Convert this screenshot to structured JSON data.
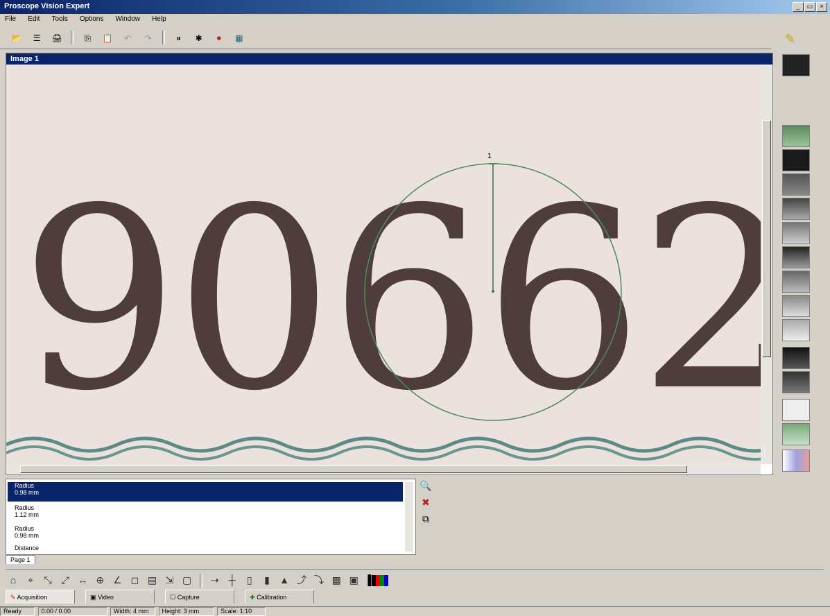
{
  "window": {
    "title": "Proscope Vision Expert",
    "controls": [
      "_",
      "▭",
      "×"
    ]
  },
  "menu": [
    "File",
    "Edit",
    "Tools",
    "Options",
    "Window",
    "Help"
  ],
  "toolbar": {
    "icons": [
      "open-icon",
      "save-icon",
      "print-icon",
      "copy-icon",
      "paste-icon",
      "undo-icon",
      "redo-icon",
      "pause-icon",
      "capture-icon",
      "record-icon",
      "settings-icon"
    ],
    "glyphs": [
      "📂",
      "☰",
      "🖨",
      "⎘",
      "📋",
      "↶",
      "↷",
      "⏸",
      "✱",
      "⏺",
      "▦"
    ]
  },
  "image_window": {
    "title": "Image 1",
    "digits": "9066",
    "partial_digit": "2",
    "measure_label": "1"
  },
  "measurements": [
    {
      "type": "Radius",
      "value": "0.98 mm"
    },
    {
      "type": "Radius",
      "value": "1.12 mm"
    },
    {
      "type": "Radius",
      "value": "0.98 mm"
    },
    {
      "type": "Distance",
      "value": ""
    }
  ],
  "measure_tools": [
    "zoom-icon",
    "eraser-icon",
    "link-icon"
  ],
  "tabs": [
    "Page 1"
  ],
  "tool_icons": [
    "⌂",
    "⌖",
    "⤡",
    "⤢",
    "↔",
    "⊕",
    "∠",
    "◻",
    "▤",
    "⇲",
    "▢",
    "⇢",
    "┼",
    "▯",
    "▮",
    "▲",
    "⤴",
    "⤵",
    "▩",
    "▣",
    "▌"
  ],
  "mode_tabs": [
    "Acquisition",
    "Video",
    "Capture",
    "Calibration"
  ],
  "status": [
    "Ready",
    "0.00 / 0.00",
    "Width: 4 mm",
    "Height: 3 mm",
    "Scale: 1:10"
  ],
  "colors": {
    "title_start": "#0a246a",
    "title_end": "#a6caf0",
    "panel": "#d4d0c8",
    "digit_ink": "#4f3d3d",
    "paper": "#ebe2de",
    "measure_green": "#4e8a5a"
  }
}
